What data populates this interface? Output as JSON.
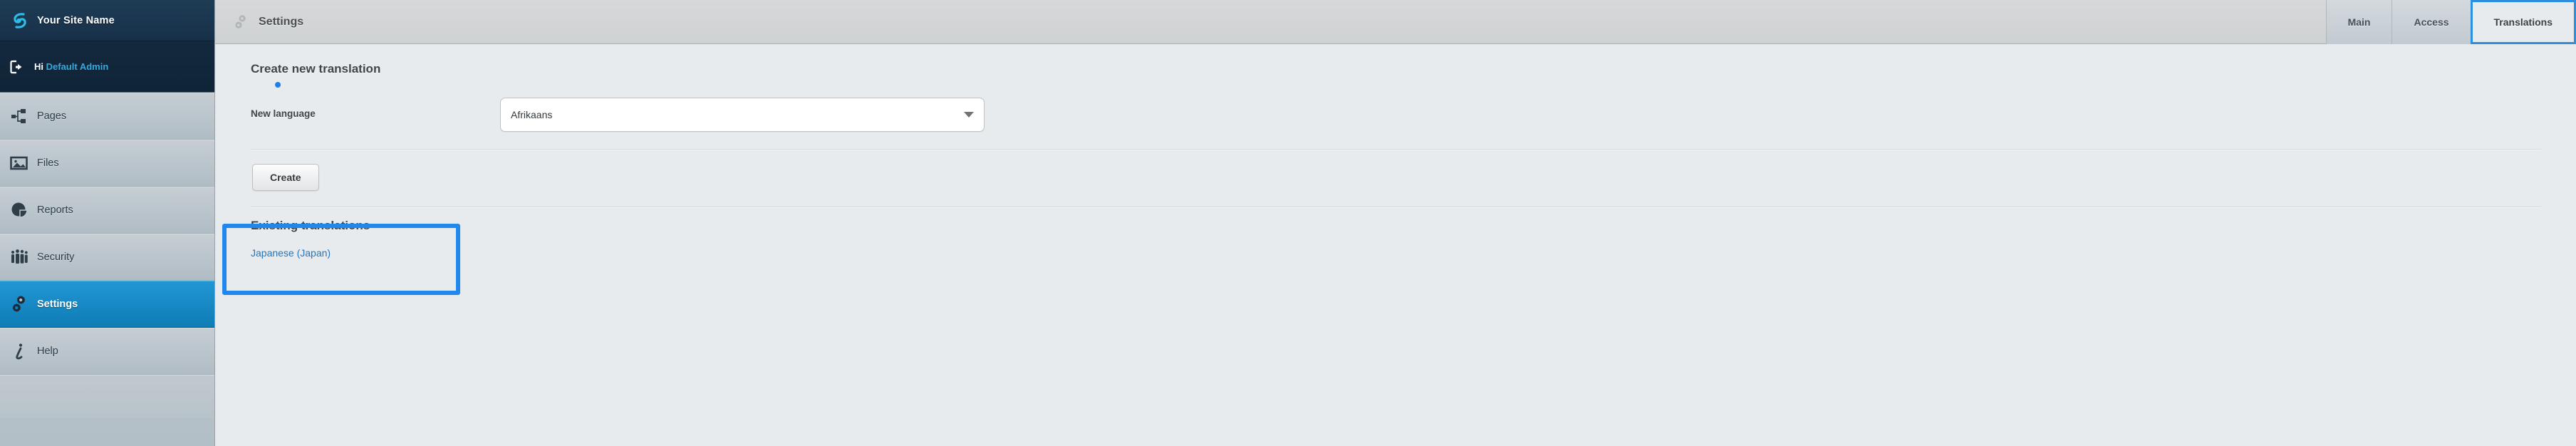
{
  "sidebar": {
    "brand": {
      "icon": "site-logo-icon",
      "title": "Your Site Name"
    },
    "user": {
      "icon": "logout-arrow-icon",
      "greeting": "Hi",
      "name": "Default Admin"
    },
    "items": [
      {
        "icon": "sitemap-icon",
        "label": "Pages",
        "active": false
      },
      {
        "icon": "image-icon",
        "label": "Files",
        "active": false
      },
      {
        "icon": "piechart-icon",
        "label": "Reports",
        "active": false
      },
      {
        "icon": "people-icon",
        "label": "Security",
        "active": false
      },
      {
        "icon": "gears-icon",
        "label": "Settings",
        "active": true
      },
      {
        "icon": "info-icon",
        "label": "Help",
        "active": false
      }
    ]
  },
  "header": {
    "icon": "gears-icon",
    "title": "Settings",
    "tabs": [
      {
        "label": "Main",
        "selected": false
      },
      {
        "label": "Access",
        "selected": false
      },
      {
        "label": "Translations",
        "selected": true
      }
    ]
  },
  "main": {
    "create_section": {
      "title": "Create new translation",
      "field_label": "New language",
      "select_value": "Afrikaans",
      "select_arrow_icon": "chevron-down-icon",
      "create_button": "Create"
    },
    "existing_section": {
      "title": "Existing translations",
      "links": [
        "Japanese (Japan)"
      ]
    }
  },
  "colors": {
    "accent_blue": "#1f87ed",
    "sidebar_active": "#0f7cb5",
    "brand_teal": "#35a8e0",
    "link_blue": "#2775b8",
    "tab_focus": "#2d8fe0"
  }
}
